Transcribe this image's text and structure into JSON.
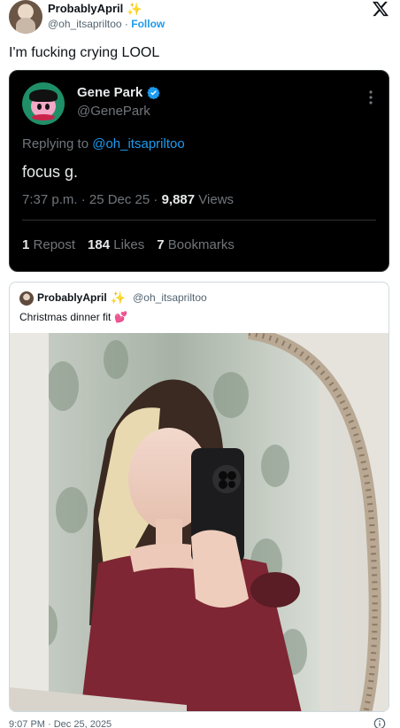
{
  "header": {
    "display_name": "ProbablyApril",
    "handle": "@oh_itsapriltoo",
    "separator": "·",
    "follow_label": "Follow"
  },
  "tweet": {
    "text": "I'm fucking crying LOOL"
  },
  "reply_card": {
    "name": "Gene Park",
    "handle": "@GenePark",
    "replying_prefix": "Replying to",
    "replying_to": "@oh_itsapriltoo",
    "text": "focus g.",
    "timestamp": "7:37 p.m. · 25 Dec 25 ·",
    "views_count": "9,887",
    "views_label": "Views",
    "reposts_count": "1",
    "reposts_label": "Repost",
    "likes_count": "184",
    "likes_label": "Likes",
    "bookmarks_count": "7",
    "bookmarks_label": "Bookmarks"
  },
  "quote_card": {
    "name": "ProbablyApril",
    "handle": "@oh_itsapriltoo",
    "text": "Christmas dinner fit"
  },
  "footer": {
    "timestamp": "9:07 PM · Dec 25, 2025"
  },
  "colors": {
    "accent": "#1d9bf0",
    "dark_card_bg": "#000000",
    "sparkle": "#f2b32a",
    "heart": "#e8246a"
  },
  "icons": [
    "x-logo-icon",
    "sparkle-icon",
    "verified-badge-icon",
    "more-icon",
    "heart-icon",
    "info-icon"
  ]
}
